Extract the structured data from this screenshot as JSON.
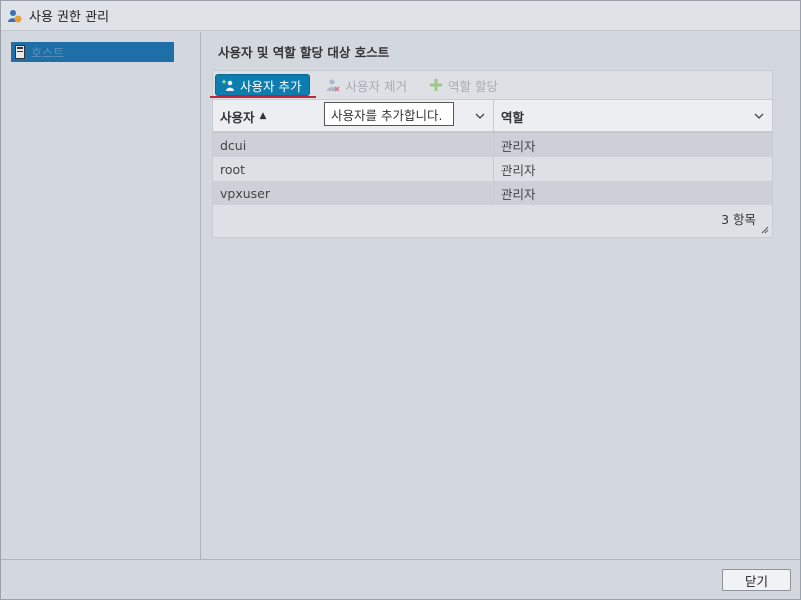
{
  "window": {
    "title": "사용 권한 관리",
    "icon": "user-permissions-icon"
  },
  "sidebar": {
    "items": [
      {
        "label": "호스트",
        "icon": "host-icon",
        "selected": true
      }
    ]
  },
  "section": {
    "title": "사용자 및 역할 할당 대상 호스트"
  },
  "toolbar": {
    "add_user": "사용자 추가",
    "remove_user": "사용자 제거",
    "assign_role": "역할 할당"
  },
  "tooltip": {
    "text": "사용자를 추가합니다."
  },
  "grid": {
    "columns": {
      "user": "사용자",
      "role": "역할"
    },
    "sort_indicator": "▲",
    "rows": [
      {
        "user": "dcui",
        "role": "관리자"
      },
      {
        "user": "root",
        "role": "관리자"
      },
      {
        "user": "vpxuser",
        "role": "관리자"
      }
    ],
    "item_count": "3 항목"
  },
  "footer": {
    "close_label": "닫기"
  },
  "colors": {
    "accent": "#0d7db0",
    "selection": "#1e6fa8",
    "underline": "#c3283a"
  }
}
